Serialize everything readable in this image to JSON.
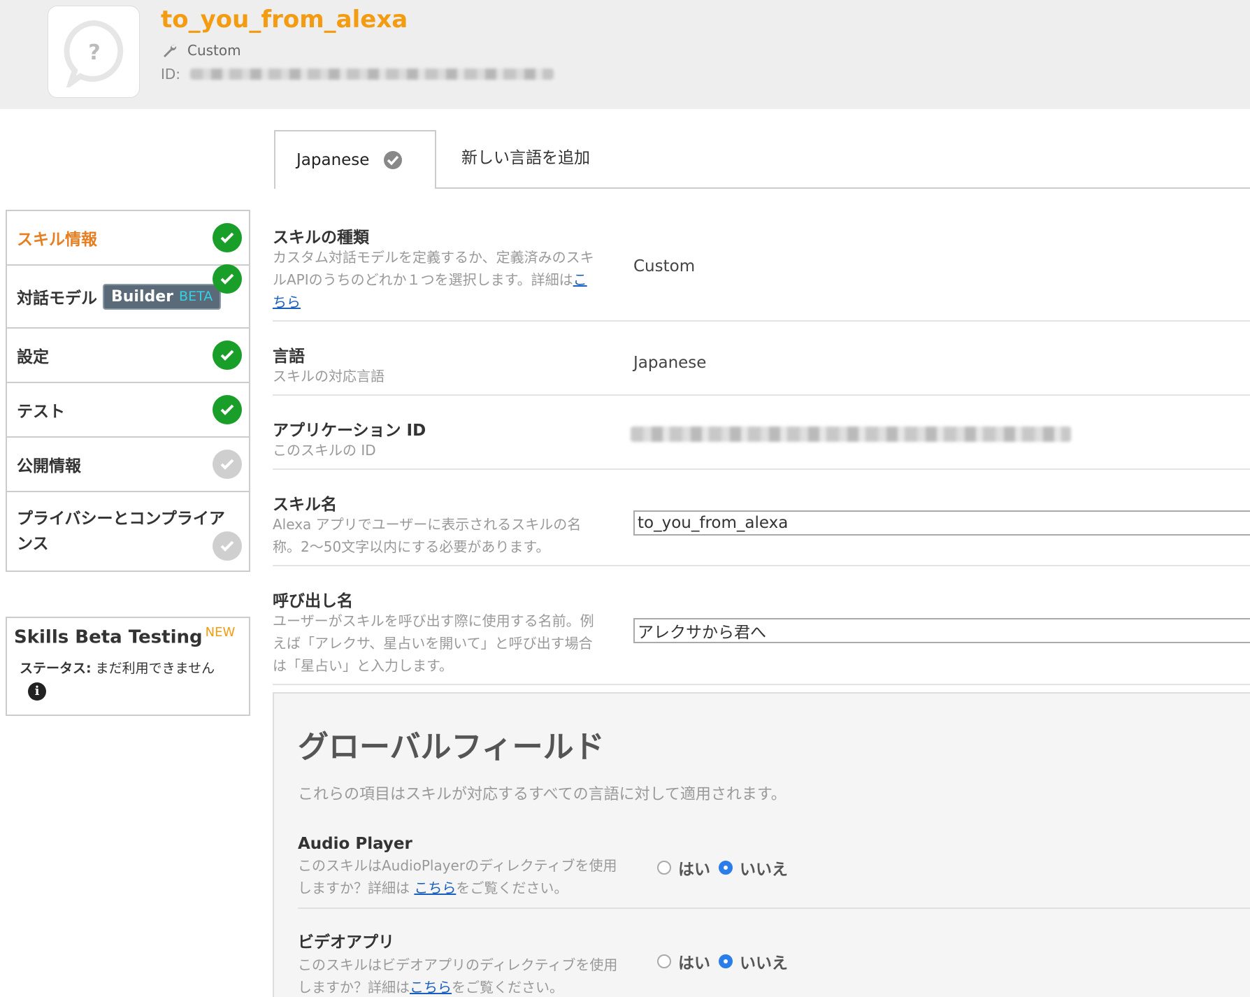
{
  "header": {
    "skill_name": "to_you_from_alexa",
    "skill_type": "Custom",
    "id_label": "ID:"
  },
  "tabs": {
    "active": "Japanese",
    "add": "新しい言語を追加"
  },
  "sidebar": {
    "items": [
      {
        "label": "スキル情報",
        "status": "complete",
        "active": true
      },
      {
        "label": "対話モデル",
        "badge": "Builder",
        "badge_sup": "BETA",
        "status": "complete"
      },
      {
        "label": "設定",
        "status": "complete"
      },
      {
        "label": "テスト",
        "status": "complete"
      },
      {
        "label": "公開情報",
        "status": "incomplete"
      },
      {
        "label": "プライバシーとコンプライア",
        "label2": "ンス",
        "status": "incomplete"
      }
    ]
  },
  "beta_testing": {
    "title": "Skills Beta Testing",
    "badge": "NEW",
    "status_label": "ステータス:",
    "status_value": "まだ利用できません"
  },
  "form": {
    "skill_type": {
      "label": "スキルの種類",
      "desc_line1": "カスタム対話モデルを定義するか、定義済みのスキ",
      "desc_line2": "ルAPIのうちのどれか１つを選択します。詳細は",
      "link_a": "こ",
      "link_b": "ちら",
      "value": "Custom"
    },
    "language": {
      "label": "言語",
      "desc": "スキルの対応言語",
      "value": "Japanese"
    },
    "app_id": {
      "label": "アプリケーション ID",
      "desc": "このスキルの ID"
    },
    "skill_name": {
      "label": "スキル名",
      "desc_line1": "Alexa アプリでユーザーに表示されるスキルの名",
      "desc_line2": "称。2〜50文字以内にする必要があります。",
      "value": "to_you_from_alexa"
    },
    "invocation": {
      "label": "呼び出し名",
      "desc_line1": "ユーザーがスキルを呼び出す際に使用する名前。例",
      "desc_line2": "えば「アレクサ、星占いを開いて」と呼び出す場合",
      "desc_line3": "は「星占い」と入力します。",
      "value": "アレクサから君へ"
    }
  },
  "global": {
    "title": "グローバルフィールド",
    "desc": "これらの項目はスキルが対応するすべての言語に対して適用されます。",
    "audio_player": {
      "label": "Audio Player",
      "desc_line1": "このスキルはAudioPlayerのディレクティブを使用",
      "desc_line2a": "しますか？詳細は ",
      "link": "こちら",
      "desc_line2b": "をご覧ください。",
      "yes": "はい",
      "no": "いいえ",
      "selected": "no"
    },
    "video_app": {
      "label": "ビデオアプリ",
      "desc_line1": "このスキルはビデオアプリのディレクティブを使用",
      "desc_line2a": "しますか？詳細は",
      "link": "こちら",
      "desc_line2b": "をご覧ください。",
      "yes": "はい",
      "no": "いいえ",
      "selected": "no"
    }
  },
  "colors": {
    "accent": "#f39c12",
    "check_done": "#1a9e2a",
    "check_pending": "#cfcfcf",
    "link": "#1a5fbd",
    "radio_on": "#2b7de9"
  }
}
